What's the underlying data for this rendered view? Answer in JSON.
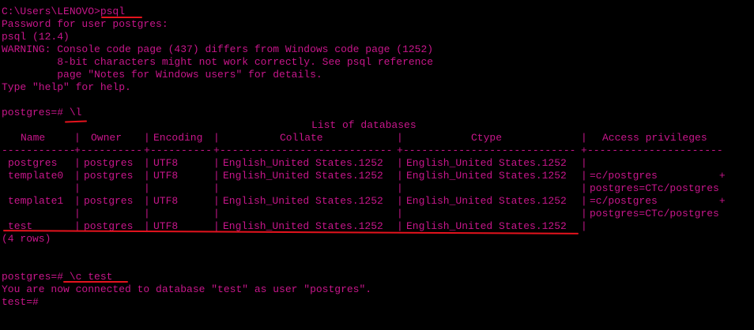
{
  "theme": {
    "background": "#000000",
    "text_color": "#c8168b",
    "annotation_color": "#e4131d"
  },
  "session": {
    "cmd_line": {
      "prompt": "C:\\Users\\LENOVO>",
      "command": "psql"
    },
    "password_prompt": "Password for user postgres:",
    "version": "psql (12.4)",
    "warning": [
      "WARNING: Console code page (437) differs from Windows code page (1252)",
      "         8-bit characters might not work correctly. See psql reference",
      "         page \"Notes for Windows users\" for details."
    ],
    "help_hint": "Type \"help\" for help.",
    "list_command": {
      "prompt": "postgres=# ",
      "command": "\\l"
    },
    "table": {
      "title": "List of databases",
      "headers": [
        "Name",
        "Owner",
        "Encoding",
        "Collate",
        "Ctype",
        "Access privileges"
      ],
      "rows": [
        [
          "postgres",
          "postgres",
          "UTF8",
          "English_United States.1252",
          "English_United States.1252",
          ""
        ],
        [
          "template0",
          "postgres",
          "UTF8",
          "English_United States.1252",
          "English_United States.1252",
          "=c/postgres          +"
        ],
        [
          "",
          "",
          "",
          "",
          "",
          "postgres=CTc/postgres"
        ],
        [
          "template1",
          "postgres",
          "UTF8",
          "English_United States.1252",
          "English_United States.1252",
          "=c/postgres          +"
        ],
        [
          "",
          "",
          "",
          "",
          "",
          "postgres=CTc/postgres"
        ],
        [
          "test",
          "postgres",
          "UTF8",
          "English_United States.1252",
          "English_United States.1252",
          ""
        ]
      ],
      "row_count": "(4 rows)"
    },
    "connect_command": {
      "prompt": "postgres=# ",
      "command": "\\c test"
    },
    "connect_message": "You are now connected to database \"test\" as user \"postgres\".",
    "final_prompt": "test=#"
  }
}
